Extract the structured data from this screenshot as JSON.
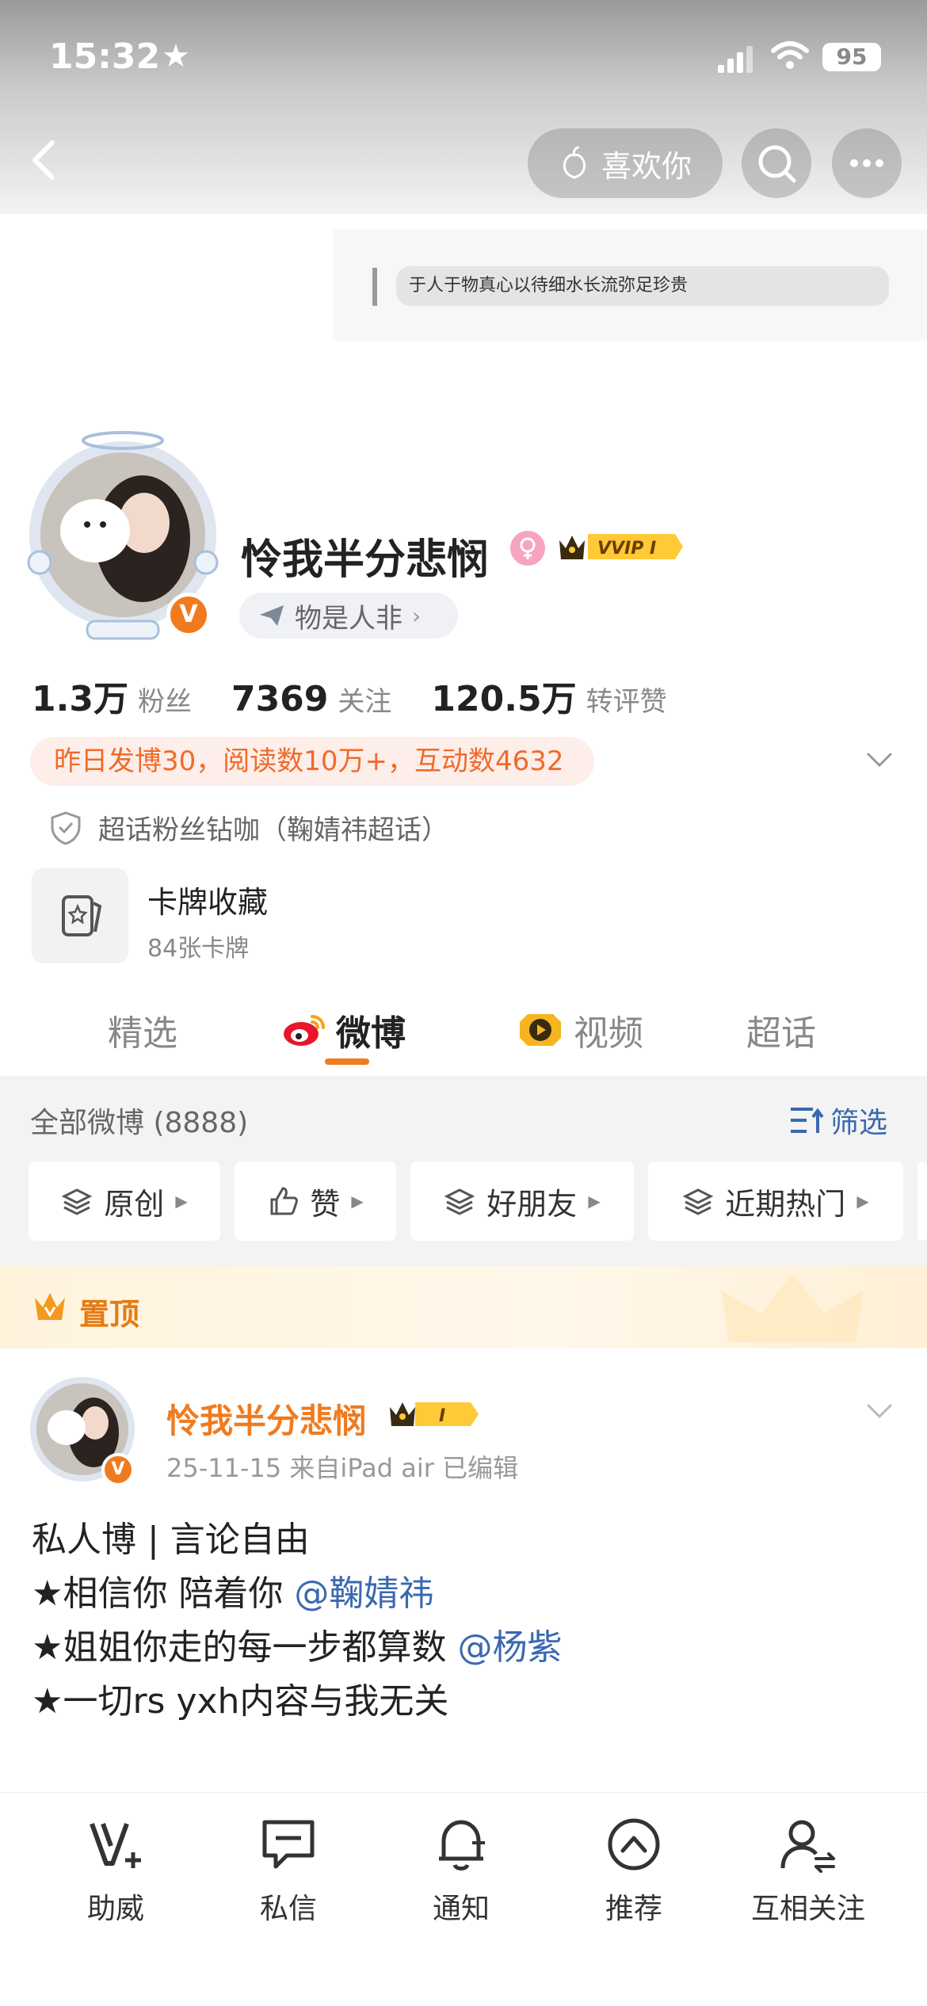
{
  "status_bar": {
    "time": "15:32",
    "battery": "95"
  },
  "header": {
    "like_label": "喜欢你"
  },
  "background": {
    "caption": "于人于物真心以待细水长流弥足珍贵"
  },
  "profile": {
    "nickname": "怜我半分悲悯",
    "vip_label": "VVIP I",
    "status": "物是人非",
    "stats": [
      {
        "value": "1.3万",
        "label": "粉丝"
      },
      {
        "value": "7369",
        "label": "关注"
      },
      {
        "value": "120.5万",
        "label": "转评赞"
      }
    ],
    "activity": "昨日发博30，阅读数10万+，互动数4632",
    "fan_title": "超话粉丝钻咖（鞠婧祎超话）",
    "cards": {
      "title": "卡牌收藏",
      "sub": "84张卡牌"
    }
  },
  "tabs": [
    {
      "label": "精选"
    },
    {
      "label": "微博"
    },
    {
      "label": "视频"
    },
    {
      "label": "超话"
    }
  ],
  "feed": {
    "count_label": "全部微博 (8888)",
    "filter_label": "筛选",
    "chips": [
      "原创",
      "赞",
      "好朋友",
      "近期热门"
    ]
  },
  "pinned": {
    "label": "置顶"
  },
  "post": {
    "author": "怜我半分悲悯",
    "badge": "I",
    "meta": "25-11-15  来自iPad air  已编辑",
    "line1": "私人博 | 言论自由",
    "line2_text": "★相信你 陪着你 ",
    "line2_mention": "@鞠婧祎",
    "line3_text": "★姐姐你走的每一步都算数 ",
    "line3_mention": "@杨紫",
    "line4": "★一切rs yxh内容与我无关"
  },
  "bottom_nav": [
    {
      "label": "助威",
      "icon": "v-plus-icon"
    },
    {
      "label": "私信",
      "icon": "chat-icon"
    },
    {
      "label": "通知",
      "icon": "bell-icon"
    },
    {
      "label": "推荐",
      "icon": "up-arrow-icon"
    },
    {
      "label": "互相关注",
      "icon": "user-follow-icon"
    }
  ],
  "colors": {
    "accent": "#f07b1f",
    "link": "#3b68b0"
  }
}
